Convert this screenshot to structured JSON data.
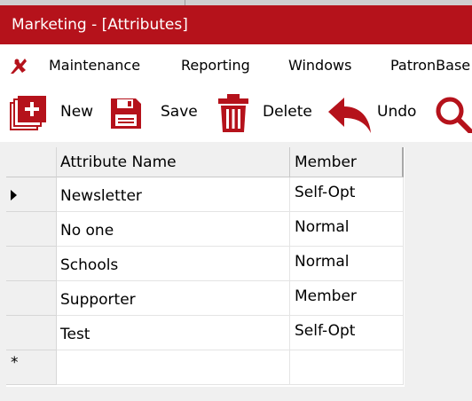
{
  "window": {
    "title": "Marketing - [Attributes]"
  },
  "menu": {
    "items": [
      {
        "label": "Maintenance"
      },
      {
        "label": "Reporting"
      },
      {
        "label": "Windows"
      },
      {
        "label": "PatronBase"
      }
    ]
  },
  "toolbar": {
    "new_label": "New",
    "save_label": "Save",
    "delete_label": "Delete",
    "undo_label": "Undo"
  },
  "grid": {
    "columns": [
      "Attribute Name",
      "Member"
    ],
    "rows": [
      {
        "name": "Newsletter",
        "member": "Self-Opt",
        "current": true
      },
      {
        "name": "No one",
        "member": "Normal"
      },
      {
        "name": "Schools",
        "member": "Normal"
      },
      {
        "name": "Supporter",
        "member": "Member"
      },
      {
        "name": "Test",
        "member": "Self-Opt"
      }
    ],
    "new_row_marker": "*"
  },
  "colors": {
    "title_bar": "#b5121b",
    "icon_red": "#b5121b"
  },
  "icons": [
    "app-logo-icon",
    "new-document-icon",
    "save-icon",
    "delete-icon",
    "undo-icon",
    "search-icon"
  ]
}
